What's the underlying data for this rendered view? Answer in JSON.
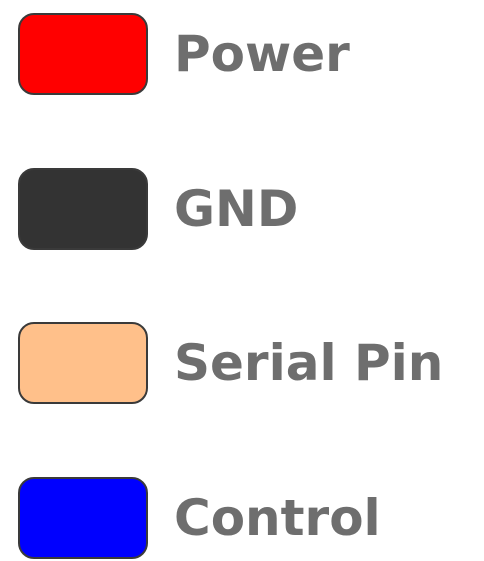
{
  "legend": {
    "items": [
      {
        "label": "Power",
        "color": "#ff0000"
      },
      {
        "label": "GND",
        "color": "#333333"
      },
      {
        "label": "Serial Pin",
        "color": "#ffc08a"
      },
      {
        "label": "Control",
        "color": "#0000ff"
      }
    ]
  }
}
